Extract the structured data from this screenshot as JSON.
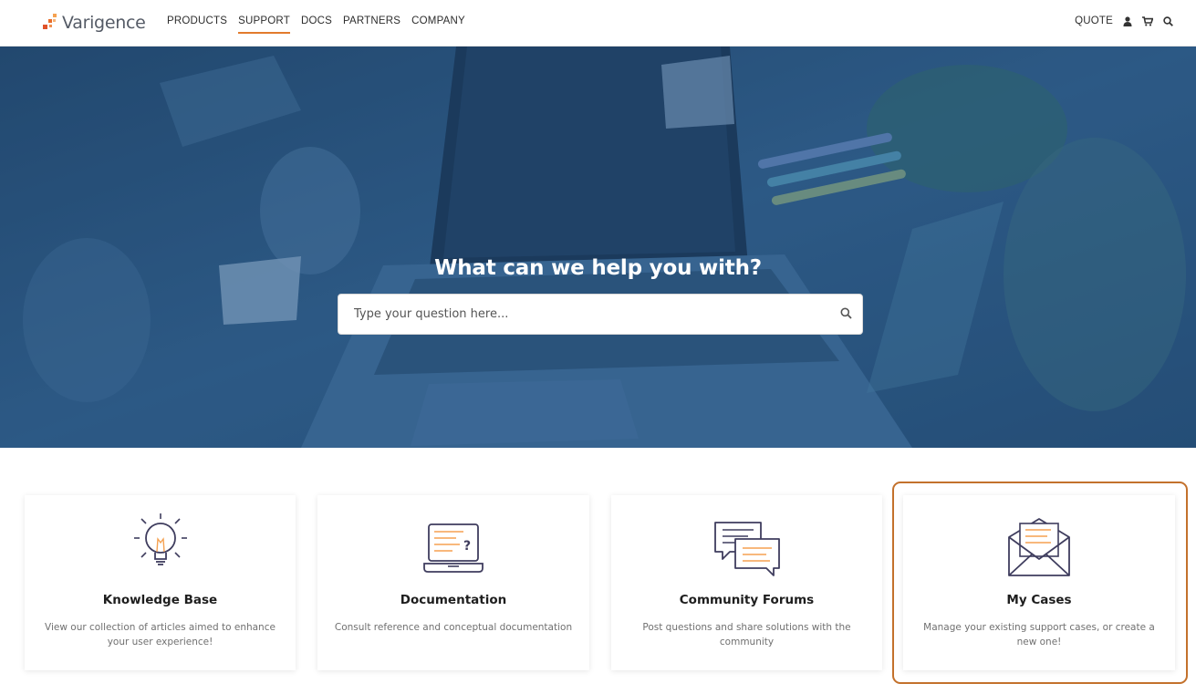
{
  "brand": {
    "name": "Varigence",
    "accent": "#e27b2d"
  },
  "nav": {
    "items": [
      {
        "label": "PRODUCTS",
        "active": false
      },
      {
        "label": "SUPPORT",
        "active": true
      },
      {
        "label": "DOCS",
        "active": false
      },
      {
        "label": "PARTNERS",
        "active": false
      },
      {
        "label": "COMPANY",
        "active": false
      }
    ],
    "right": {
      "quote_label": "QUOTE",
      "icons": [
        "user-icon",
        "cart-icon",
        "search-icon"
      ]
    }
  },
  "hero": {
    "title": "What can we help you with?",
    "search_placeholder": "Type your question here...",
    "overlay_color": "#2b5682"
  },
  "cards": [
    {
      "title": "Knowledge Base",
      "description": "View our collection of articles aimed to enhance your user experience!",
      "icon": "lightbulb-icon"
    },
    {
      "title": "Documentation",
      "description": "Consult reference and conceptual documentation",
      "icon": "laptop-help-icon"
    },
    {
      "title": "Community Forums",
      "description": "Post questions and share solutions with the community",
      "icon": "chat-bubbles-icon"
    },
    {
      "title": "My Cases",
      "description": "Manage your existing support cases, or create a new one!",
      "icon": "envelope-icon",
      "highlighted": true
    }
  ],
  "colors": {
    "icon_stroke": "#3f3d5e",
    "icon_accent": "#f5a150",
    "highlight_border": "#c3712c"
  }
}
